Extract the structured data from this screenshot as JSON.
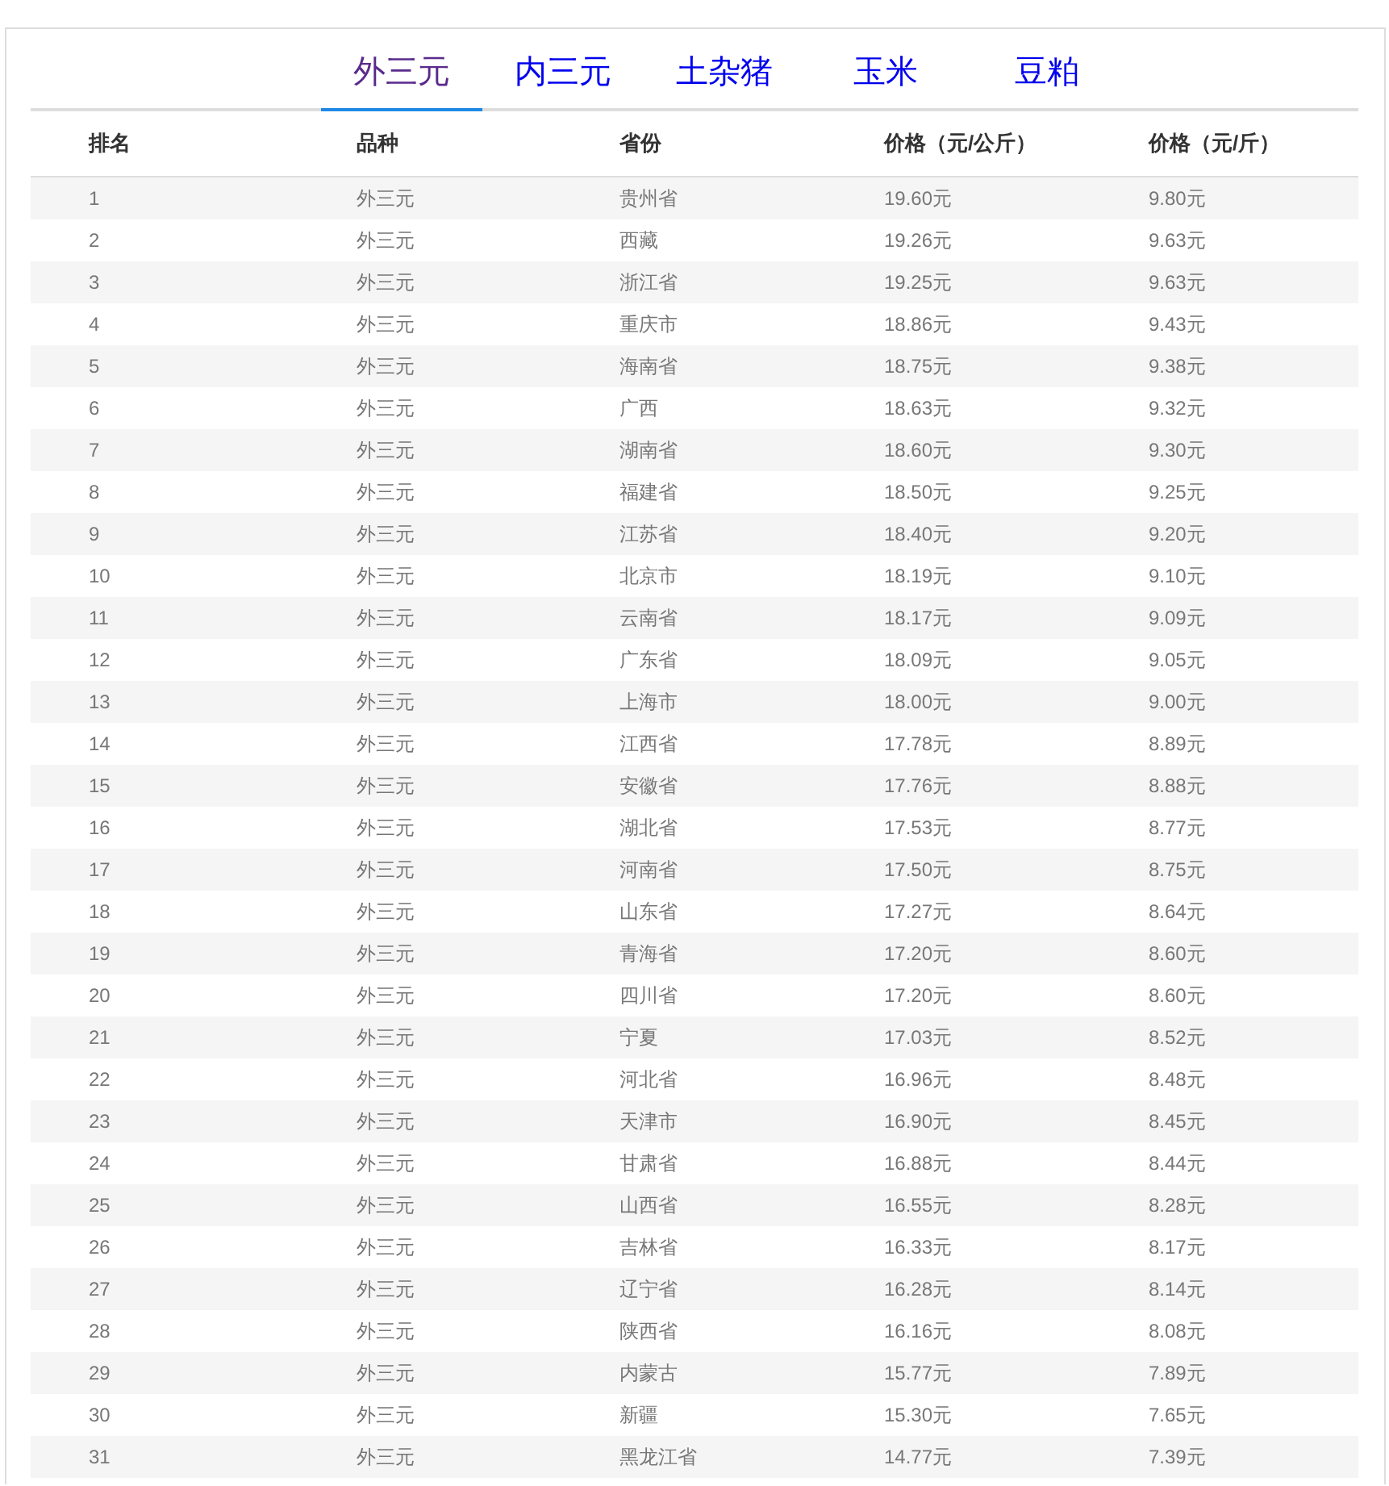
{
  "tabs": [
    {
      "label": "外三元",
      "selected": true
    },
    {
      "label": "内三元",
      "selected": false
    },
    {
      "label": "土杂猪",
      "selected": false
    },
    {
      "label": "玉米",
      "selected": false
    },
    {
      "label": "豆粕",
      "selected": false
    }
  ],
  "table": {
    "columns": [
      "排名",
      "品种",
      "省份",
      "价格（元/公斤）",
      "价格（元/斤）"
    ],
    "rows": [
      [
        "1",
        "外三元",
        "贵州省",
        "19.60元",
        "9.80元"
      ],
      [
        "2",
        "外三元",
        "西藏",
        "19.26元",
        "9.63元"
      ],
      [
        "3",
        "外三元",
        "浙江省",
        "19.25元",
        "9.63元"
      ],
      [
        "4",
        "外三元",
        "重庆市",
        "18.86元",
        "9.43元"
      ],
      [
        "5",
        "外三元",
        "海南省",
        "18.75元",
        "9.38元"
      ],
      [
        "6",
        "外三元",
        "广西",
        "18.63元",
        "9.32元"
      ],
      [
        "7",
        "外三元",
        "湖南省",
        "18.60元",
        "9.30元"
      ],
      [
        "8",
        "外三元",
        "福建省",
        "18.50元",
        "9.25元"
      ],
      [
        "9",
        "外三元",
        "江苏省",
        "18.40元",
        "9.20元"
      ],
      [
        "10",
        "外三元",
        "北京市",
        "18.19元",
        "9.10元"
      ],
      [
        "11",
        "外三元",
        "云南省",
        "18.17元",
        "9.09元"
      ],
      [
        "12",
        "外三元",
        "广东省",
        "18.09元",
        "9.05元"
      ],
      [
        "13",
        "外三元",
        "上海市",
        "18.00元",
        "9.00元"
      ],
      [
        "14",
        "外三元",
        "江西省",
        "17.78元",
        "8.89元"
      ],
      [
        "15",
        "外三元",
        "安徽省",
        "17.76元",
        "8.88元"
      ],
      [
        "16",
        "外三元",
        "湖北省",
        "17.53元",
        "8.77元"
      ],
      [
        "17",
        "外三元",
        "河南省",
        "17.50元",
        "8.75元"
      ],
      [
        "18",
        "外三元",
        "山东省",
        "17.27元",
        "8.64元"
      ],
      [
        "19",
        "外三元",
        "青海省",
        "17.20元",
        "8.60元"
      ],
      [
        "20",
        "外三元",
        "四川省",
        "17.20元",
        "8.60元"
      ],
      [
        "21",
        "外三元",
        "宁夏",
        "17.03元",
        "8.52元"
      ],
      [
        "22",
        "外三元",
        "河北省",
        "16.96元",
        "8.48元"
      ],
      [
        "23",
        "外三元",
        "天津市",
        "16.90元",
        "8.45元"
      ],
      [
        "24",
        "外三元",
        "甘肃省",
        "16.88元",
        "8.44元"
      ],
      [
        "25",
        "外三元",
        "山西省",
        "16.55元",
        "8.28元"
      ],
      [
        "26",
        "外三元",
        "吉林省",
        "16.33元",
        "8.17元"
      ],
      [
        "27",
        "外三元",
        "辽宁省",
        "16.28元",
        "8.14元"
      ],
      [
        "28",
        "外三元",
        "陕西省",
        "16.16元",
        "8.08元"
      ],
      [
        "29",
        "外三元",
        "内蒙古",
        "15.77元",
        "7.89元"
      ],
      [
        "30",
        "外三元",
        "新疆",
        "15.30元",
        "7.65元"
      ],
      [
        "31",
        "外三元",
        "黑龙江省",
        "14.77元",
        "7.39元"
      ]
    ]
  }
}
